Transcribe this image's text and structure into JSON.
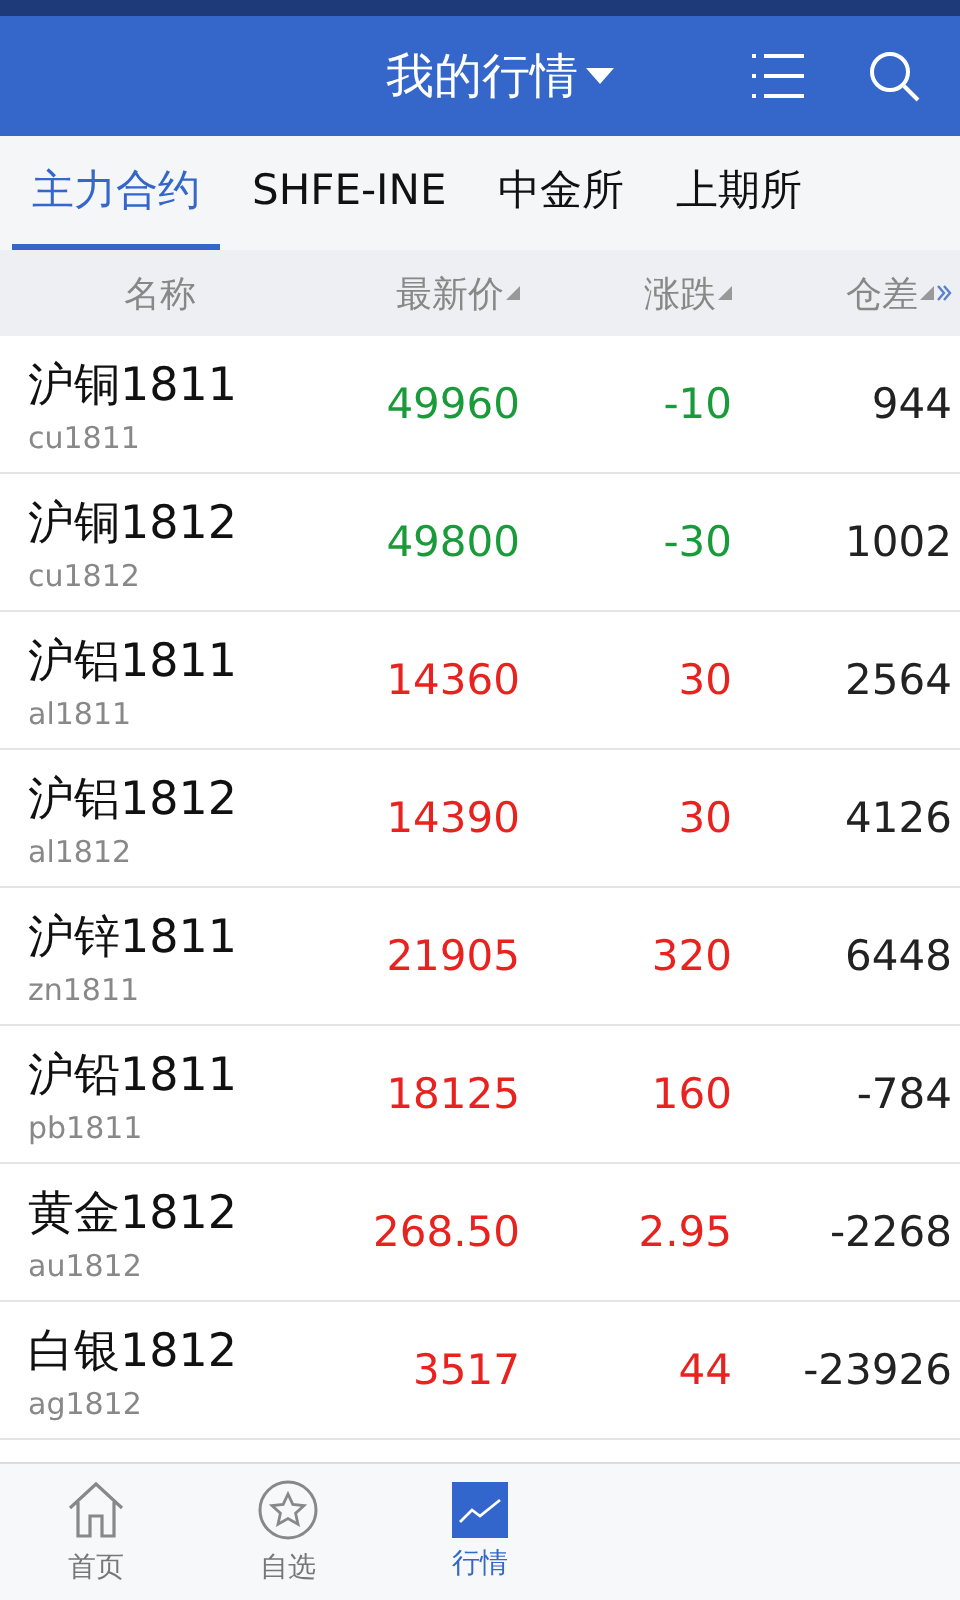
{
  "header": {
    "title": "我的行情"
  },
  "tabs": [
    {
      "label": "主力合约",
      "selected": true
    },
    {
      "label": "SHFE-INE",
      "selected": false
    },
    {
      "label": "中金所",
      "selected": false
    },
    {
      "label": "上期所",
      "selected": false
    }
  ],
  "columns": [
    "名称",
    "最新价",
    "涨跌",
    "仓差"
  ],
  "rows": [
    {
      "name": "沪铜1811",
      "code": "cu1811",
      "price": "49960",
      "change": "-10",
      "oi_change": "944",
      "kind": "down"
    },
    {
      "name": "沪铜1812",
      "code": "cu1812",
      "price": "49800",
      "change": "-30",
      "oi_change": "1002",
      "kind": "down"
    },
    {
      "name": "沪铝1811",
      "code": "al1811",
      "price": "14360",
      "change": "30",
      "oi_change": "2564",
      "kind": "up"
    },
    {
      "name": "沪铝1812",
      "code": "al1812",
      "price": "14390",
      "change": "30",
      "oi_change": "4126",
      "kind": "up"
    },
    {
      "name": "沪锌1811",
      "code": "zn1811",
      "price": "21905",
      "change": "320",
      "oi_change": "6448",
      "kind": "up"
    },
    {
      "name": "沪铅1811",
      "code": "pb1811",
      "price": "18125",
      "change": "160",
      "oi_change": "-784",
      "kind": "up"
    },
    {
      "name": "黄金1812",
      "code": "au1812",
      "price": "268.50",
      "change": "2.95",
      "oi_change": "-2268",
      "kind": "up"
    },
    {
      "name": "白银1812",
      "code": "ag1812",
      "price": "3517",
      "change": "44",
      "oi_change": "-23926",
      "kind": "up"
    }
  ],
  "nav": [
    {
      "label": "首页",
      "kind": "home",
      "selected": false
    },
    {
      "label": "自选",
      "kind": "star",
      "selected": false
    },
    {
      "label": "行情",
      "kind": "chart",
      "selected": true
    }
  ]
}
